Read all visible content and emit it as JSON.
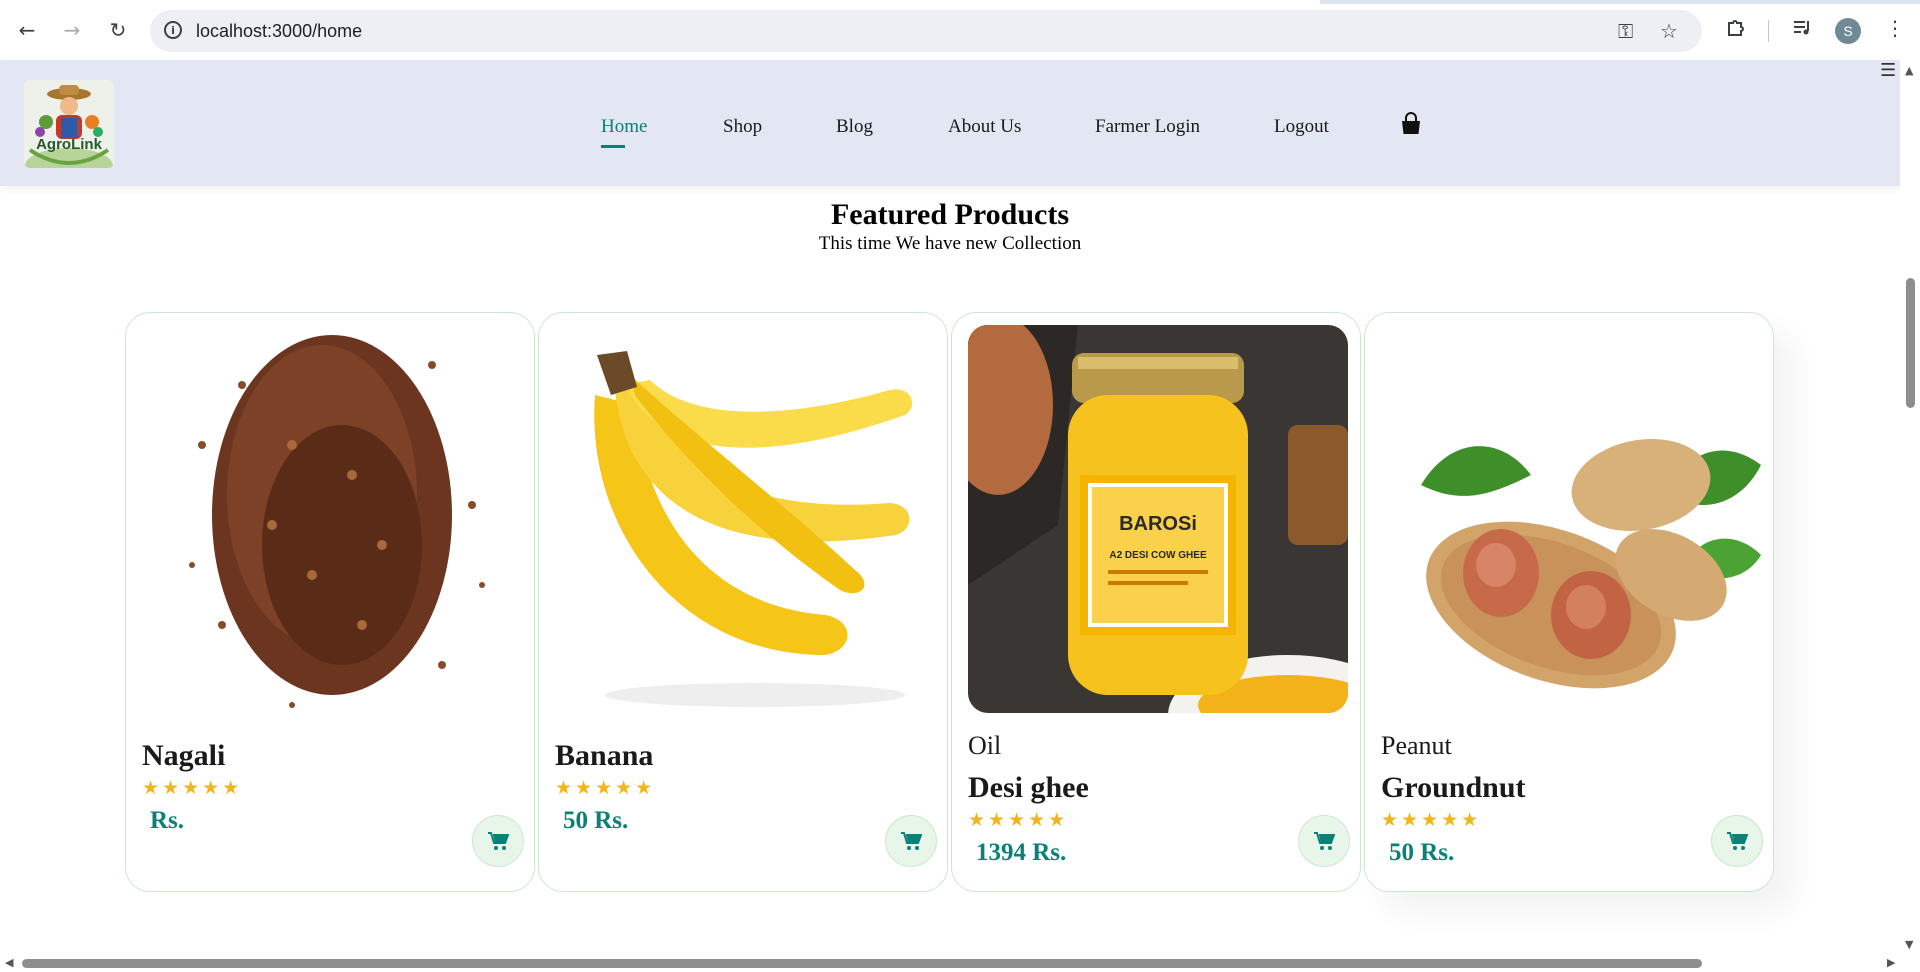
{
  "browser": {
    "url": "localhost:3000/home",
    "profile_initial": "S"
  },
  "site": {
    "logo_text": "AgroLink",
    "nav": [
      {
        "label": "Home",
        "active": true
      },
      {
        "label": "Shop",
        "active": false
      },
      {
        "label": "Blog",
        "active": false
      },
      {
        "label": "About Us",
        "active": false
      },
      {
        "label": "Farmer Login",
        "active": false
      },
      {
        "label": "Logout",
        "active": false
      }
    ],
    "accent_color": "#088178",
    "header_bg": "#e3e6f3"
  },
  "section": {
    "title": "Featured Products",
    "subtitle": "This time We have new Collection"
  },
  "products": [
    {
      "brand": "",
      "name": "Nagali",
      "rating": 5,
      "stars": "★★★★★",
      "price": "Rs.",
      "image": "finger-millet-grains"
    },
    {
      "brand": "",
      "name": "Banana",
      "rating": 5,
      "stars": "★★★★★",
      "price": "50 Rs.",
      "image": "banana-bunch"
    },
    {
      "brand": "Oil",
      "name": "Desi ghee",
      "rating": 5,
      "stars": "★★★★★",
      "price": "1394 Rs.",
      "image": "ghee-jar"
    },
    {
      "brand": "Peanut",
      "name": "Groundnut",
      "rating": 5,
      "stars": "★★★★★",
      "price": "50 Rs.",
      "image": "peanuts"
    }
  ],
  "jar_label": {
    "brand": "BAROSi",
    "product": "A2 DESI COW GHEE"
  },
  "icons": {
    "back": "back-arrow-icon",
    "forward": "forward-arrow-icon",
    "reload": "reload-icon",
    "site_info": "info-icon",
    "password": "key-icon",
    "bookmark": "star-icon",
    "extensions": "puzzle-icon",
    "media": "media-queue-icon",
    "menu": "kebab-menu-icon",
    "bag": "shopping-bag-icon",
    "cart": "cart-icon"
  }
}
